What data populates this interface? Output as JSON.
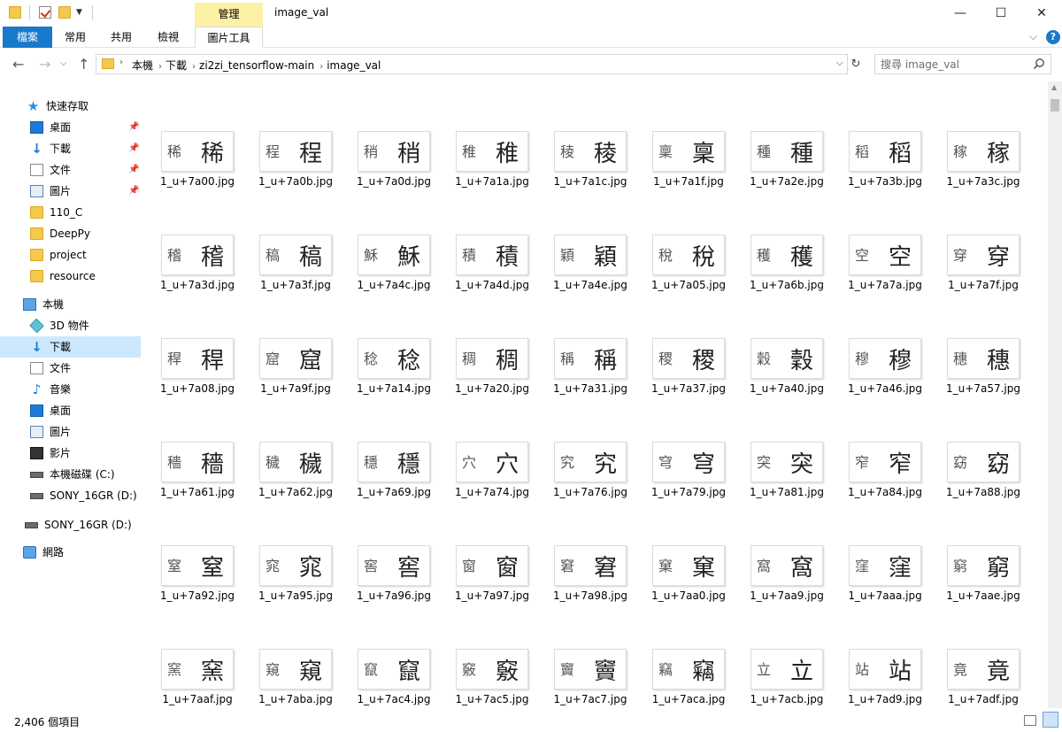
{
  "window": {
    "title": "image_val",
    "manage_tab": "管理",
    "minimize": "—",
    "maximize": "☐",
    "close": "✕"
  },
  "ribbon": {
    "tabs": [
      "檔案",
      "常用",
      "共用",
      "檢視",
      "圖片工具"
    ],
    "expand_icon": "chevron-down-icon",
    "help_icon": "help-icon",
    "help_label": "?"
  },
  "address": {
    "crumbs": [
      "本機",
      "下載",
      "zi2zi_tensorflow-main",
      "image_val"
    ],
    "separator": "›"
  },
  "search": {
    "placeholder": "搜尋 image_val"
  },
  "sidebar": {
    "items": [
      {
        "label": "快速存取",
        "icon": "star-icon"
      },
      {
        "label": "桌面",
        "icon": "desktop-icon"
      },
      {
        "label": "下載",
        "icon": "download-icon"
      },
      {
        "label": "文件",
        "icon": "document-icon"
      },
      {
        "label": "圖片",
        "icon": "picture-icon"
      },
      {
        "label": "110_C",
        "icon": "folder-icon"
      },
      {
        "label": "DeepPy",
        "icon": "folder-icon"
      },
      {
        "label": "project",
        "icon": "folder-icon"
      },
      {
        "label": "resource",
        "icon": "folder-icon"
      },
      {
        "label": "本機",
        "icon": "computer-icon"
      },
      {
        "label": "3D 物件",
        "icon": "3d-objects-icon"
      },
      {
        "label": "下載",
        "icon": "download-icon"
      },
      {
        "label": "文件",
        "icon": "document-icon"
      },
      {
        "label": "音樂",
        "icon": "music-icon"
      },
      {
        "label": "桌面",
        "icon": "desktop-icon"
      },
      {
        "label": "圖片",
        "icon": "picture-icon"
      },
      {
        "label": "影片",
        "icon": "video-icon"
      },
      {
        "label": "本機磁碟 (C:)",
        "icon": "drive-icon"
      },
      {
        "label": "SONY_16GR (D:)",
        "icon": "usb-drive-icon"
      },
      {
        "label": "SONY_16GR (D:)",
        "icon": "usb-drive-icon"
      },
      {
        "label": "網路",
        "icon": "network-icon"
      }
    ]
  },
  "files": [
    {
      "name": "1_u+7a00.jpg",
      "char": "稀"
    },
    {
      "name": "1_u+7a0b.jpg",
      "char": "程"
    },
    {
      "name": "1_u+7a0d.jpg",
      "char": "稍"
    },
    {
      "name": "1_u+7a1a.jpg",
      "char": "稚"
    },
    {
      "name": "1_u+7a1c.jpg",
      "char": "稜"
    },
    {
      "name": "1_u+7a1f.jpg",
      "char": "稟"
    },
    {
      "name": "1_u+7a2e.jpg",
      "char": "種"
    },
    {
      "name": "1_u+7a3b.jpg",
      "char": "稻"
    },
    {
      "name": "1_u+7a3c.jpg",
      "char": "稼"
    },
    {
      "name": "1_u+7a3d.jpg",
      "char": "稽"
    },
    {
      "name": "1_u+7a3f.jpg",
      "char": "稿"
    },
    {
      "name": "1_u+7a4c.jpg",
      "char": "穌"
    },
    {
      "name": "1_u+7a4d.jpg",
      "char": "積"
    },
    {
      "name": "1_u+7a4e.jpg",
      "char": "穎"
    },
    {
      "name": "1_u+7a05.jpg",
      "char": "稅"
    },
    {
      "name": "1_u+7a6b.jpg",
      "char": "穫"
    },
    {
      "name": "1_u+7a7a.jpg",
      "char": "空"
    },
    {
      "name": "1_u+7a7f.jpg",
      "char": "穿"
    },
    {
      "name": "1_u+7a08.jpg",
      "char": "稈"
    },
    {
      "name": "1_u+7a9f.jpg",
      "char": "窟"
    },
    {
      "name": "1_u+7a14.jpg",
      "char": "稔"
    },
    {
      "name": "1_u+7a20.jpg",
      "char": "稠"
    },
    {
      "name": "1_u+7a31.jpg",
      "char": "稱"
    },
    {
      "name": "1_u+7a37.jpg",
      "char": "稷"
    },
    {
      "name": "1_u+7a40.jpg",
      "char": "穀"
    },
    {
      "name": "1_u+7a46.jpg",
      "char": "穆"
    },
    {
      "name": "1_u+7a57.jpg",
      "char": "穗"
    },
    {
      "name": "1_u+7a61.jpg",
      "char": "穡"
    },
    {
      "name": "1_u+7a62.jpg",
      "char": "穢"
    },
    {
      "name": "1_u+7a69.jpg",
      "char": "穩"
    },
    {
      "name": "1_u+7a74.jpg",
      "char": "穴"
    },
    {
      "name": "1_u+7a76.jpg",
      "char": "究"
    },
    {
      "name": "1_u+7a79.jpg",
      "char": "穹"
    },
    {
      "name": "1_u+7a81.jpg",
      "char": "突"
    },
    {
      "name": "1_u+7a84.jpg",
      "char": "窄"
    },
    {
      "name": "1_u+7a88.jpg",
      "char": "窈"
    },
    {
      "name": "1_u+7a92.jpg",
      "char": "窒"
    },
    {
      "name": "1_u+7a95.jpg",
      "char": "窕"
    },
    {
      "name": "1_u+7a96.jpg",
      "char": "窖"
    },
    {
      "name": "1_u+7a97.jpg",
      "char": "窗"
    },
    {
      "name": "1_u+7a98.jpg",
      "char": "窘"
    },
    {
      "name": "1_u+7aa0.jpg",
      "char": "窠"
    },
    {
      "name": "1_u+7aa9.jpg",
      "char": "窩"
    },
    {
      "name": "1_u+7aaa.jpg",
      "char": "窪"
    },
    {
      "name": "1_u+7aae.jpg",
      "char": "窮"
    },
    {
      "name": "1_u+7aaf.jpg",
      "char": "窯"
    },
    {
      "name": "1_u+7aba.jpg",
      "char": "窺"
    },
    {
      "name": "1_u+7ac4.jpg",
      "char": "竄"
    },
    {
      "name": "1_u+7ac5.jpg",
      "char": "竅"
    },
    {
      "name": "1_u+7ac7.jpg",
      "char": "竇"
    },
    {
      "name": "1_u+7aca.jpg",
      "char": "竊"
    },
    {
      "name": "1_u+7acb.jpg",
      "char": "立"
    },
    {
      "name": "1_u+7ad9.jpg",
      "char": "站"
    },
    {
      "name": "1_u+7adf.jpg",
      "char": "竟"
    }
  ],
  "status": {
    "item_count": "2,406 個項目"
  },
  "colors": {
    "accent": "#1979ca",
    "selected": "#cce8ff",
    "manage_tab": "#fcf1a4"
  }
}
